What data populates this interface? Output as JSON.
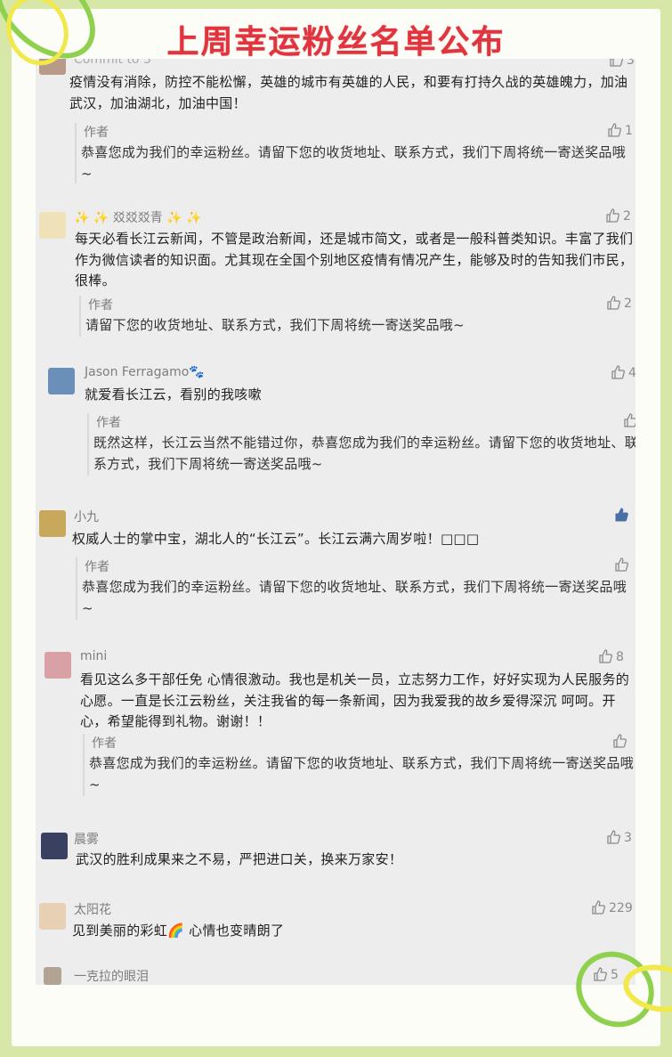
{
  "title": "上周幸运粉丝名单公布",
  "comments": [
    {
      "nick": "Commit to 3",
      "likes": "3",
      "text": "疫情没有消除，防控不能松懈，英雄的城市有英雄的人民，和要有打持久战的英雄魄力，加油武汉，加油湖北，加油中国！",
      "reply_author": "作者",
      "reply_likes": "1",
      "reply": "恭喜您成为我们的幸运粉丝。请留下您的收货地址、联系方式，我们下周将统一寄送奖品哦~"
    },
    {
      "nick": "✨ ✨ 㸚㸚㸚青 ✨ ✨",
      "likes": "2",
      "text": "每天必看长江云新闻，不管是政治新闻，还是城市简文，或者是一般科普类知识。丰富了我们作为微信读者的知识面。尤其现在全国个别地区疫情有情况产生，能够及时的告知我们市民，很棒。",
      "reply_author": "作者",
      "reply_likes": "2",
      "reply": "请留下您的收货地址、联系方式，我们下周将统一寄送奖品哦~"
    },
    {
      "nick": "Jason Ferragamo🐾",
      "likes": "4",
      "text": "就爱看长江云，看别的我咳嗽",
      "reply_author": "作者",
      "reply_likes": "",
      "reply": "既然这样，长江云当然不能错过你，恭喜您成为我们的幸运粉丝。请留下您的收货地址、联系方式，我们下周将统一寄送奖品哦~"
    },
    {
      "nick": "小九",
      "likes": "",
      "text": "权威人士的掌中宝，湖北人的“长江云”。长江云满六周岁啦！□□□",
      "reply_author": "作者",
      "reply_likes": "",
      "reply": "恭喜您成为我们的幸运粉丝。请留下您的收货地址、联系方式，我们下周将统一寄送奖品哦~"
    },
    {
      "nick": "mini",
      "likes": "8",
      "text": "看见这么多干部任免 心情很激动。我也是机关一员，立志努力工作，好好实现为人民服务的心愿。一直是长江云粉丝，关注我省的每一条新闻，因为我爱我的故乡爱得深沉 呵呵。开心，希望能得到礼物。谢谢！！",
      "reply_author": "作者",
      "reply_likes": "",
      "reply": "恭喜您成为我们的幸运粉丝。请留下您的收货地址、联系方式，我们下周将统一寄送奖品哦~"
    },
    {
      "nick": "晨雾",
      "likes": "3",
      "text": "武汉的胜利成果来之不易，严把进口关，换来万家安！"
    },
    {
      "nick": "太阳花",
      "likes": "229",
      "text": "见到美丽的彩虹🌈 心情也变晴朗了"
    },
    {
      "nick": "一克拉的眼泪",
      "likes": "5"
    }
  ],
  "colors": {
    "title": "#e0343f",
    "frame": "#d6e7a7",
    "clip": "#8fd14f",
    "clip_yellow": "#f1e94b"
  }
}
